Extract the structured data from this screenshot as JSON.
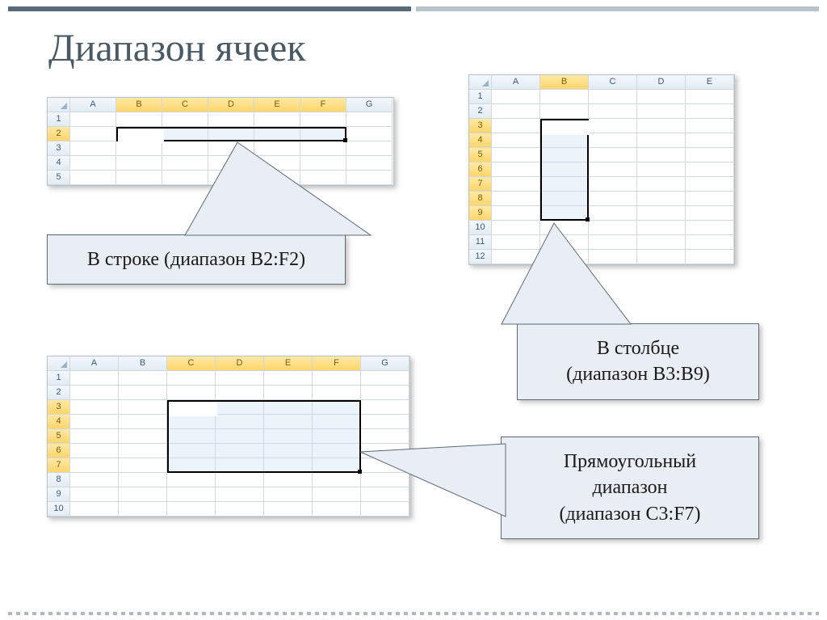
{
  "title": "Диапазон ячеек",
  "grids": {
    "row": {
      "cols": [
        "A",
        "B",
        "C",
        "D",
        "E",
        "F",
        "G"
      ],
      "rows": [
        "1",
        "2",
        "3",
        "4",
        "5"
      ],
      "active_cols": [
        "B",
        "C",
        "D",
        "E",
        "F"
      ],
      "active_rows": [
        "2"
      ],
      "selection": "B2:F2"
    },
    "col": {
      "cols": [
        "A",
        "B",
        "C",
        "D",
        "E"
      ],
      "rows": [
        "1",
        "2",
        "3",
        "4",
        "5",
        "6",
        "7",
        "8",
        "9",
        "10",
        "11",
        "12"
      ],
      "active_cols": [
        "B"
      ],
      "active_rows": [
        "3",
        "4",
        "5",
        "6",
        "7",
        "8",
        "9"
      ],
      "selection": "B3:B9"
    },
    "rect": {
      "cols": [
        "A",
        "B",
        "C",
        "D",
        "E",
        "F",
        "G"
      ],
      "rows": [
        "1",
        "2",
        "3",
        "4",
        "5",
        "6",
        "7",
        "8",
        "9",
        "10"
      ],
      "active_cols": [
        "C",
        "D",
        "E",
        "F"
      ],
      "active_rows": [
        "3",
        "4",
        "5",
        "6",
        "7"
      ],
      "selection": "C3:F7"
    }
  },
  "callouts": {
    "row": "В строке (диапазон  B2:F2)",
    "col_l1": "В столбце",
    "col_l2": "(диапазон  B3:B9)",
    "rect_l1": "Прямоугольный",
    "rect_l2": "диапазон",
    "rect_l3": "(диапазон  C3:F7)"
  }
}
